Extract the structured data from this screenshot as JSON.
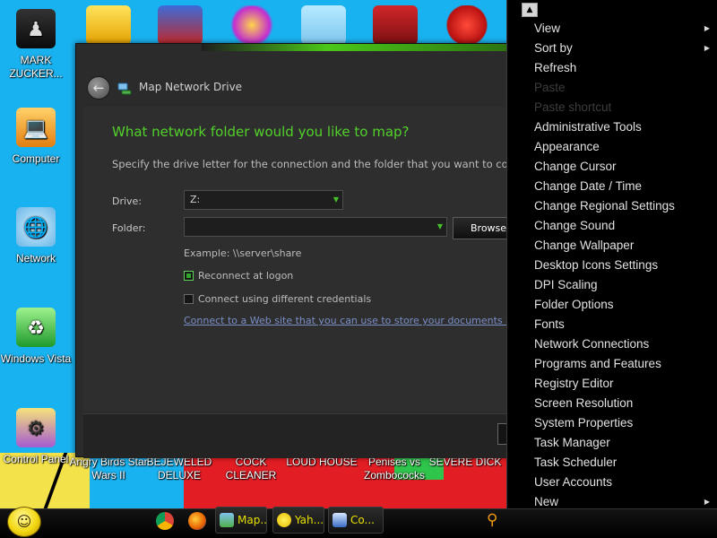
{
  "desktop": {
    "icons": [
      {
        "label": "MARK ZUCKER...",
        "icon": "person-figure-icon"
      },
      {
        "label": "Computer",
        "icon": "computer-icon"
      },
      {
        "label": "Network",
        "icon": "network-icon"
      },
      {
        "label": "Windows Vista",
        "icon": "recycle-bin-icon"
      },
      {
        "label": "Control Panel",
        "icon": "control-panel-icon"
      }
    ],
    "bottom_labels": [
      "Angry Birds Star Wars II",
      "BEJEWELED DELUXE",
      "COCK CLEANER",
      "LOUD HOUSE",
      "Penises vs Zombococks",
      "SEVERE DICK"
    ]
  },
  "dialog": {
    "title": "Map Network Drive",
    "heading": "What network folder would you like to map?",
    "description": "Specify the drive letter for the connection and the folder that you want to connect",
    "drive_label": "Drive:",
    "drive_value": "Z:",
    "folder_label": "Folder:",
    "folder_value": "",
    "browse_label": "Browse",
    "example": "Example: \\\\server\\share",
    "reconnect_label": "Reconnect at logon",
    "reconnect_checked": true,
    "credentials_label": "Connect using different credentials",
    "credentials_checked": false,
    "web_link": "Connect to a Web site that you can use to store your documents and"
  },
  "context_menu": {
    "items": [
      {
        "label": "View",
        "submenu": true,
        "enabled": true
      },
      {
        "label": "Sort by",
        "submenu": true,
        "enabled": true
      },
      {
        "label": "Refresh",
        "submenu": false,
        "enabled": true
      },
      {
        "label": "Paste",
        "submenu": false,
        "enabled": false
      },
      {
        "label": "Paste shortcut",
        "submenu": false,
        "enabled": false
      },
      {
        "label": "Administrative Tools",
        "submenu": false,
        "enabled": true
      },
      {
        "label": "Appearance",
        "submenu": false,
        "enabled": true
      },
      {
        "label": "Change Cursor",
        "submenu": false,
        "enabled": true
      },
      {
        "label": "Change Date / Time",
        "submenu": false,
        "enabled": true
      },
      {
        "label": "Change Regional Settings",
        "submenu": false,
        "enabled": true
      },
      {
        "label": "Change Sound",
        "submenu": false,
        "enabled": true
      },
      {
        "label": "Change Wallpaper",
        "submenu": false,
        "enabled": true
      },
      {
        "label": "Desktop Icons Settings",
        "submenu": false,
        "enabled": true
      },
      {
        "label": "DPI Scaling",
        "submenu": false,
        "enabled": true
      },
      {
        "label": "Folder Options",
        "submenu": false,
        "enabled": true
      },
      {
        "label": "Fonts",
        "submenu": false,
        "enabled": true
      },
      {
        "label": "Network Connections",
        "submenu": false,
        "enabled": true
      },
      {
        "label": "Programs and Features",
        "submenu": false,
        "enabled": true
      },
      {
        "label": "Registry Editor",
        "submenu": false,
        "enabled": true
      },
      {
        "label": "Screen Resolution",
        "submenu": false,
        "enabled": true
      },
      {
        "label": "System Properties",
        "submenu": false,
        "enabled": true
      },
      {
        "label": "Task Manager",
        "submenu": false,
        "enabled": true
      },
      {
        "label": "Task Scheduler",
        "submenu": false,
        "enabled": true
      },
      {
        "label": "User Accounts",
        "submenu": false,
        "enabled": true
      },
      {
        "label": "New",
        "submenu": true,
        "enabled": true
      }
    ]
  },
  "taskbar": {
    "buttons": [
      {
        "label": "Map...",
        "icon": "network-drive-icon"
      },
      {
        "label": "Yah...",
        "icon": "yahoo-messenger-icon"
      },
      {
        "label": "Co...",
        "icon": "control-panel-icon"
      }
    ],
    "quick_launch": [
      "chrome-icon",
      "firefox-icon"
    ]
  },
  "colors": {
    "desktop_bg": "#19b2f0",
    "dialog_bg": "#2b2b2b",
    "heading_green": "#52d12a",
    "menu_bg": "#000000",
    "menu_text": "#e2e2e2",
    "menu_disabled": "#3d3d3d"
  }
}
